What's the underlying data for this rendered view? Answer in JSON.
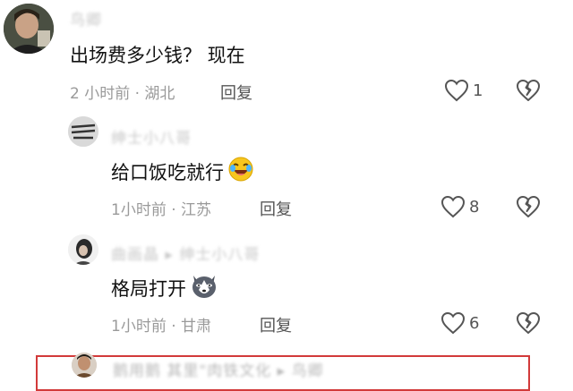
{
  "comments": [
    {
      "username": "鸟卿",
      "text": "出场费多少钱？ 现在",
      "meta": "2 小时前 · 湖北",
      "reply_label": "回复",
      "likes": "1"
    },
    {
      "username": "绅士小八哥",
      "text": "给口饭吃就行",
      "meta": "1小时前 · 江苏",
      "reply_label": "回复",
      "likes": "8"
    },
    {
      "username": "曲画晶 ▸ 绅士小八哥",
      "text": "格局打开",
      "meta": "1小时前 · 甘肃",
      "reply_label": "回复",
      "likes": "6"
    },
    {
      "username": "鹅用鹅 其里\"肉铁文化 ▸ 鸟卿"
    }
  ],
  "colors": {
    "highlight": "#d23a3a",
    "meta_text": "#9a9a9a"
  }
}
